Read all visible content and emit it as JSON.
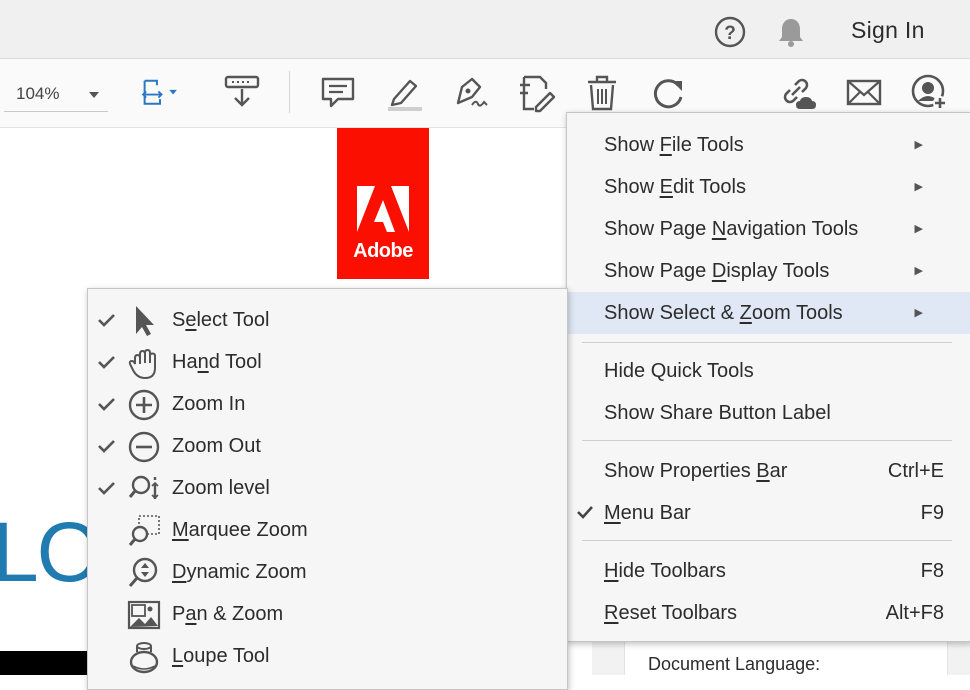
{
  "topbar": {
    "help_icon": "question-circle-icon",
    "bell_icon": "bell-icon",
    "sign_in": "Sign In"
  },
  "toolbar": {
    "zoom_value": "104%",
    "icons": [
      "fit-page-icon",
      "scroll-mode-icon",
      "comment-icon",
      "highlight-icon",
      "sign-icon",
      "edit-pdf-icon",
      "delete-icon",
      "rotate-icon",
      "share-link-icon",
      "email-icon",
      "add-user-icon"
    ]
  },
  "document": {
    "logo_text": "Adobe",
    "big_text": "LOU",
    "doc_language_label": "Document Language:"
  },
  "context_menu": {
    "items": [
      {
        "pre": "Show ",
        "u": "F",
        "post": "ile Tools",
        "has_submenu": true
      },
      {
        "pre": "Show ",
        "u": "E",
        "post": "dit Tools",
        "has_submenu": true
      },
      {
        "pre": "Show Page ",
        "u": "N",
        "post": "avigation Tools",
        "has_submenu": true
      },
      {
        "pre": "Show Page ",
        "u": "D",
        "post": "isplay Tools",
        "has_submenu": true
      },
      {
        "pre": "Show Select & ",
        "u": "Z",
        "post": "oom Tools",
        "has_submenu": true,
        "highlighted": true
      },
      {
        "pre": "Hide Quick Tools",
        "u": "",
        "post": ""
      },
      {
        "pre": "Show Share Button Label",
        "u": "",
        "post": ""
      },
      {
        "pre": "Show Properties ",
        "u": "B",
        "post": "ar",
        "shortcut": "Ctrl+E"
      },
      {
        "pre": "",
        "u": "M",
        "post": "enu Bar",
        "shortcut": "F9",
        "checked": true
      },
      {
        "pre": "",
        "u": "H",
        "post": "ide Toolbars",
        "shortcut": "F8"
      },
      {
        "pre": "",
        "u": "R",
        "post": "eset Toolbars",
        "shortcut": "Alt+F8"
      }
    ]
  },
  "submenu": {
    "items": [
      {
        "pre": "S",
        "u": "e",
        "post": "lect Tool",
        "checked": true,
        "icon": "arrow-pointer-icon"
      },
      {
        "pre": "Ha",
        "u": "n",
        "post": "d Tool",
        "checked": true,
        "icon": "hand-icon"
      },
      {
        "pre": "Zoom In",
        "u": "",
        "post": "",
        "checked": true,
        "icon": "zoom-in-icon"
      },
      {
        "pre": "Zoom Out",
        "u": "",
        "post": "",
        "checked": true,
        "icon": "zoom-out-icon"
      },
      {
        "pre": "Zoom level",
        "u": "",
        "post": "",
        "checked": true,
        "icon": "zoom-level-icon"
      },
      {
        "pre": "",
        "u": "M",
        "post": "arquee Zoom",
        "checked": false,
        "icon": "marquee-zoom-icon"
      },
      {
        "pre": "",
        "u": "D",
        "post": "ynamic Zoom",
        "checked": false,
        "icon": "dynamic-zoom-icon"
      },
      {
        "pre": "P",
        "u": "a",
        "post": "n & Zoom",
        "checked": false,
        "icon": "pan-zoom-icon"
      },
      {
        "pre": "",
        "u": "L",
        "post": "oupe Tool",
        "checked": false,
        "icon": "loupe-icon"
      }
    ]
  }
}
